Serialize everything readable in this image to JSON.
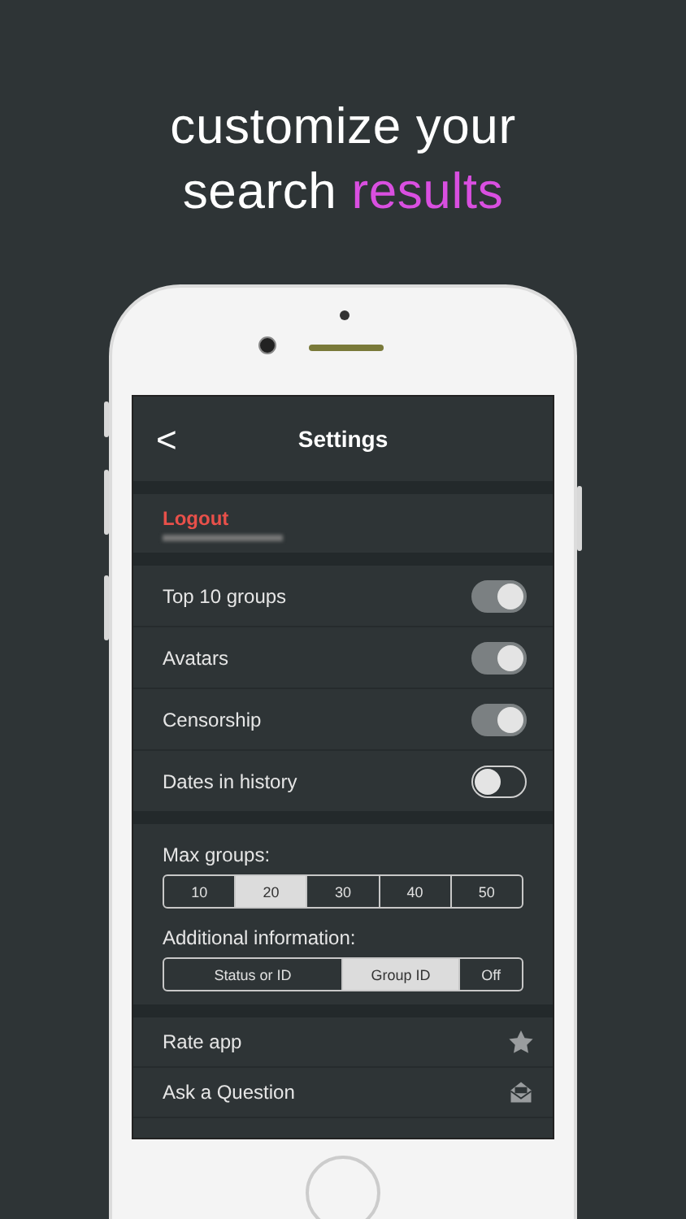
{
  "headline": {
    "line_1": "customize your",
    "line_2": "search",
    "highlight": "results"
  },
  "screen": {
    "back": "<",
    "title": "Settings",
    "account": {
      "action": "Logout"
    },
    "toggles": [
      {
        "label": "Top 10 groups",
        "on": true
      },
      {
        "label": "Avatars",
        "on": true
      },
      {
        "label": "Censorship",
        "on": true
      },
      {
        "label": "Dates in history",
        "on": false
      }
    ],
    "max_groups": {
      "label": "Max groups:",
      "options": [
        {
          "label": "10",
          "selected": false
        },
        {
          "label": "20",
          "selected": true
        },
        {
          "label": "30",
          "selected": false
        },
        {
          "label": "40",
          "selected": false
        },
        {
          "label": "50",
          "selected": false
        }
      ]
    },
    "additional_information": {
      "label": "Additional information:",
      "options": [
        {
          "label": "Status or ID",
          "selected": false
        },
        {
          "label": "Group ID",
          "selected": true
        },
        {
          "label": "Off",
          "selected": false
        }
      ]
    },
    "links": [
      {
        "label": "Rate app",
        "kind": "star"
      },
      {
        "label": "Ask a Question",
        "kind": "mail"
      }
    ]
  }
}
